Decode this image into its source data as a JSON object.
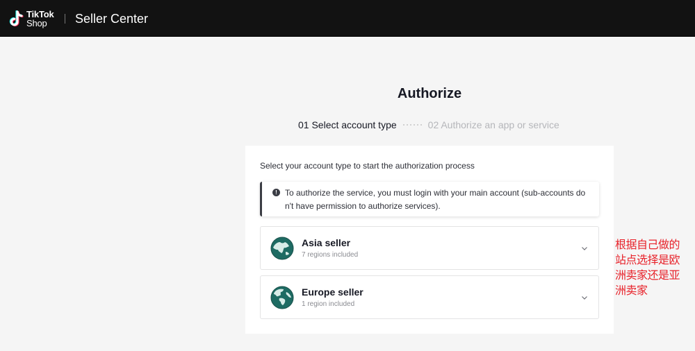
{
  "header": {
    "logo_line1": "TikTok",
    "logo_line2": "Shop",
    "product_name": "Seller Center"
  },
  "page": {
    "title": "Authorize"
  },
  "steps": {
    "step1": "01 Select account type",
    "step2": "02 Authorize an app or service"
  },
  "card": {
    "instruction": "Select your account type to start the authorization process",
    "notice": "To authorize the service, you must login with your main account (sub-accounts don't have permission to authorize services).",
    "options": [
      {
        "title": "Asia seller",
        "subtitle": "7 regions included",
        "icon": "globe-asia-icon"
      },
      {
        "title": "Europe seller",
        "subtitle": "1 region included",
        "icon": "globe-europe-icon"
      }
    ]
  },
  "annotation": "根据自己做的站点选择是欧洲卖家还是亚洲卖家",
  "colors": {
    "header_bg": "#121212",
    "page_bg": "#f5f5f5",
    "globe_teal": "#1e6b63",
    "annotation_red": "#e8232b"
  }
}
